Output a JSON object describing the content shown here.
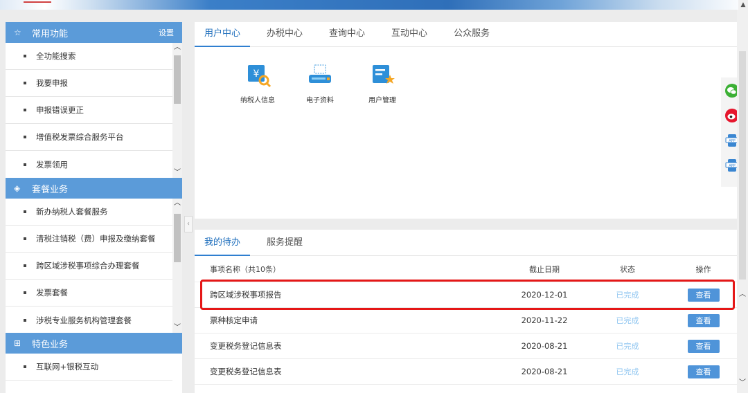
{
  "sidebar": {
    "groups": [
      {
        "title": "常用功能",
        "setting": "设置",
        "items": [
          "全功能搜索",
          "我要申报",
          "申报错误更正",
          "增值税发票综合服务平台",
          "发票领用"
        ]
      },
      {
        "title": "套餐业务",
        "items": [
          "新办纳税人套餐服务",
          "清税注销税（费）申报及缴纳套餐",
          "跨区域涉税事项综合办理套餐",
          "发票套餐",
          "涉税专业服务机构管理套餐"
        ]
      },
      {
        "title": "特色业务",
        "items": [
          "互联网+银税互动"
        ]
      }
    ]
  },
  "main_tabs": [
    "用户中心",
    "办税中心",
    "查询中心",
    "互动中心",
    "公众服务"
  ],
  "apps": [
    {
      "label": "纳税人信息",
      "icon": "taxpayer-info-icon"
    },
    {
      "label": "电子资料",
      "icon": "electronic-docs-icon"
    },
    {
      "label": "用户管理",
      "icon": "user-management-icon"
    }
  ],
  "social": [
    "wechat-icon",
    "weibo-icon",
    "app-icon",
    "app-icon"
  ],
  "todo": {
    "tabs": [
      "我的待办",
      "服务提醒"
    ],
    "headers": {
      "name": "事项名称（共10条）",
      "date": "截止日期",
      "status": "状态",
      "op": "操作"
    },
    "rows": [
      {
        "name": "跨区域涉税事项报告",
        "date": "2020-12-01",
        "status": "已完成",
        "op": "查看"
      },
      {
        "name": "票种核定申请",
        "date": "2020-11-22",
        "status": "已完成",
        "op": "查看"
      },
      {
        "name": "变更税务登记信息表",
        "date": "2020-08-21",
        "status": "已完成",
        "op": "查看"
      },
      {
        "name": "变更税务登记信息表",
        "date": "2020-08-21",
        "status": "已完成",
        "op": "查看"
      }
    ]
  },
  "colors": {
    "accent": "#5b9bd9",
    "tab_active": "#1f6fbd",
    "status_done": "#8ec5f0",
    "highlight_border": "#e51717"
  }
}
